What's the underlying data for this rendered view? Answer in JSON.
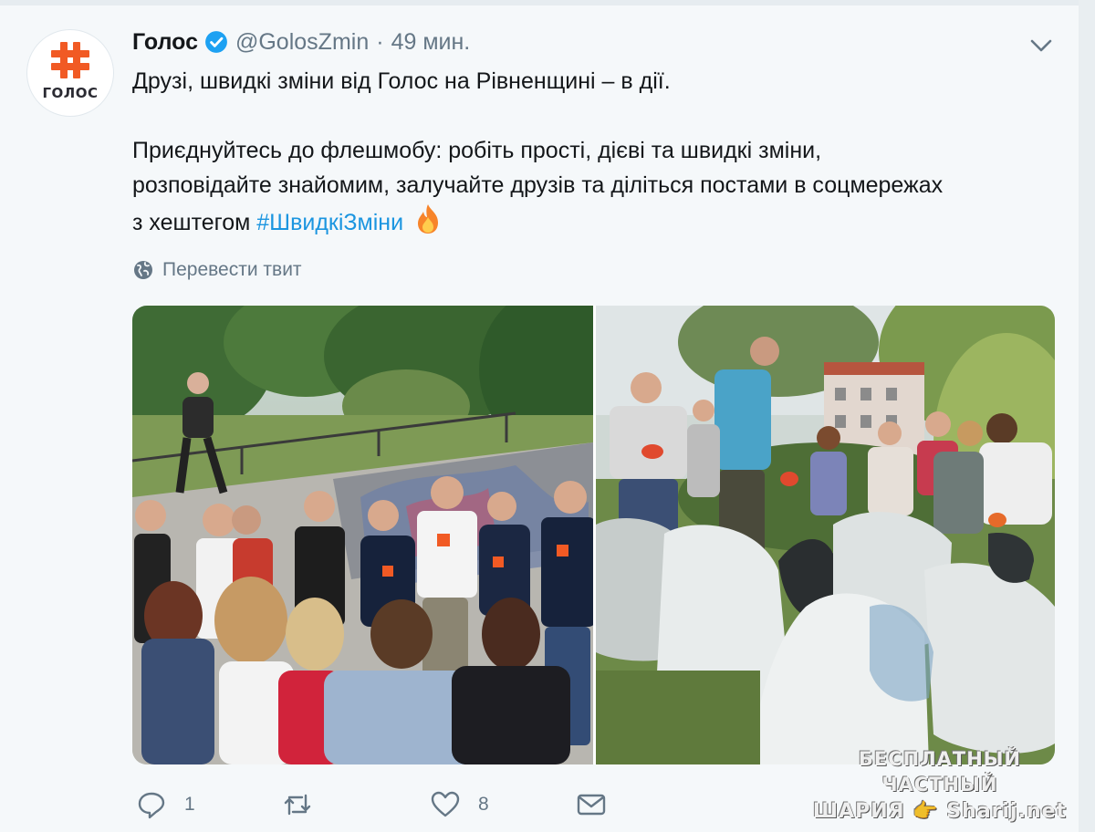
{
  "tweet": {
    "avatar_text": "ГОЛОС",
    "name": "Голос",
    "handle": "@GolosZmin",
    "separator": "·",
    "time": "49 мин.",
    "line1": "Друзі, швидкі зміни від Голос на Рівненщині – в дії.",
    "line2": "Приєднуйтесь до флешмобу: робіть прості, дієві та швидкі зміни,",
    "line3": "розповідайте знайомим, залучайте друзів та діліться постами в соцмережах",
    "line4_prefix": "з хештегом ",
    "hashtag": "#ШвидкіЗміни",
    "translate": "Перевести твит"
  },
  "actions": {
    "reply_count": "1",
    "retweet_count": "",
    "like_count": "8"
  },
  "watermark": {
    "line1": "БЕСПЛАТНЫЙ ЧАСТНЫЙ",
    "line2": "ШАРИЯ 👉 Sharij.net"
  },
  "icons": {
    "verified": "verified-badge-icon",
    "chevron": "chevron-down-icon",
    "globe": "globe-icon",
    "fire": "fire-emoji-icon",
    "reply": "reply-icon",
    "retweet": "retweet-icon",
    "like": "heart-icon",
    "dm": "envelope-icon"
  },
  "colors": {
    "brand_orange": "#f15a24",
    "link_blue": "#1b95e0",
    "verified_blue": "#1da1f2",
    "muted_text": "#657786"
  }
}
